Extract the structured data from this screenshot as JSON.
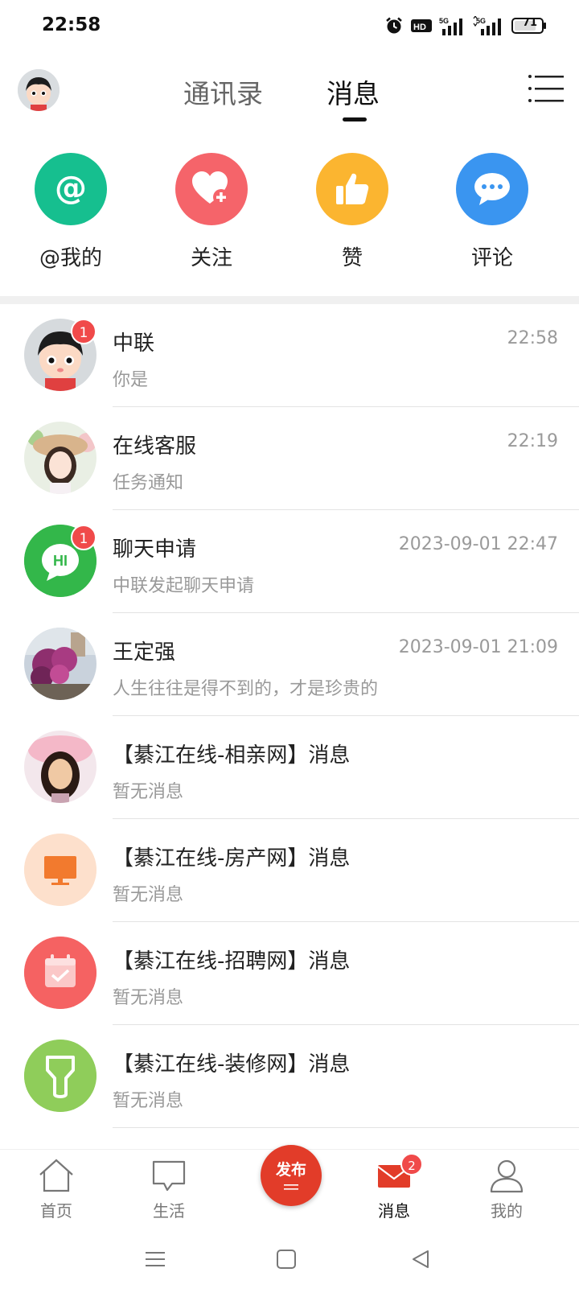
{
  "status_bar": {
    "time": "22:58",
    "icons": [
      "alarm-icon",
      "hd-icon",
      "signal-5g-icon",
      "signal-5g-icon",
      "battery-icon"
    ],
    "battery": "71"
  },
  "header": {
    "tabs": [
      {
        "label": "通讯录",
        "active": false
      },
      {
        "label": "消息",
        "active": true
      }
    ]
  },
  "quick_actions": [
    {
      "label": "@我的",
      "icon": "at-icon",
      "color": "#16bf8f"
    },
    {
      "label": "关注",
      "icon": "heart-plus-icon",
      "color": "#f5646a"
    },
    {
      "label": "赞",
      "icon": "thumbs-up-icon",
      "color": "#fbb530"
    },
    {
      "label": "评论",
      "icon": "comment-icon",
      "color": "#3a95f0"
    }
  ],
  "conversations": [
    {
      "name": "中联",
      "preview": "你是",
      "time": "22:58",
      "badge": "1",
      "avatar": "cartoon-boy-avatar"
    },
    {
      "name": "在线客服",
      "preview": "任务通知",
      "time": "22:19",
      "badge": "",
      "avatar": "service-photo-avatar"
    },
    {
      "name": "聊天申请",
      "preview": "中联发起聊天申请",
      "time": "2023-09-01 22:47",
      "badge": "1",
      "avatar": "hi-chat-icon"
    },
    {
      "name": "王定强",
      "preview": "人生往往是得不到的，才是珍贵的",
      "time": "2023-09-01 21:09",
      "badge": "",
      "avatar": "flowers-photo-avatar"
    },
    {
      "name": "【綦江在线-相亲网】消息",
      "preview": "暂无消息",
      "time": "",
      "badge": "",
      "avatar": "portrait-photo-avatar"
    },
    {
      "name": "【綦江在线-房产网】消息",
      "preview": "暂无消息",
      "time": "",
      "badge": "",
      "avatar": "monitor-icon"
    },
    {
      "name": "【綦江在线-招聘网】消息",
      "preview": "暂无消息",
      "time": "",
      "badge": "",
      "avatar": "calendar-check-icon"
    },
    {
      "name": "【綦江在线-装修网】消息",
      "preview": "暂无消息",
      "time": "",
      "badge": "",
      "avatar": "brush-icon"
    }
  ],
  "bottom_nav": {
    "items": [
      {
        "label": "首页",
        "icon": "home-icon"
      },
      {
        "label": "生活",
        "icon": "chat-bubble-icon"
      },
      {
        "label": "发布",
        "icon": "publish-icon"
      },
      {
        "label": "消息",
        "icon": "mail-icon",
        "badge": "2",
        "active": true
      },
      {
        "label": "我的",
        "icon": "user-icon"
      }
    ]
  },
  "colors": {
    "accent_red": "#e23c29",
    "badge_red": "#f04a4a"
  }
}
